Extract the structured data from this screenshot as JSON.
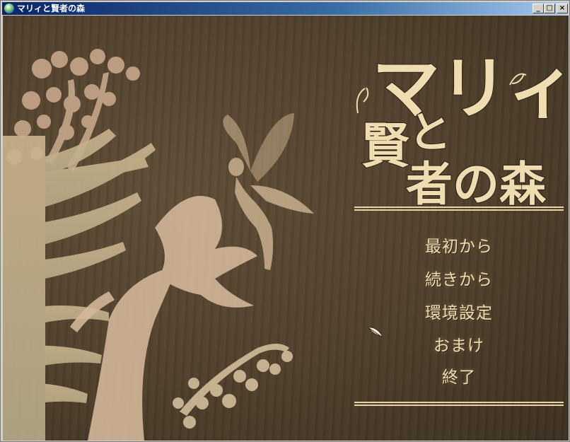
{
  "window": {
    "title": "マリィと賢者の森",
    "controls": {
      "minimize": "_",
      "maximize": "□",
      "close": "×"
    }
  },
  "logo": {
    "line1": "マリィ",
    "line2a": "賢",
    "line2b": "と",
    "line3": "者の森"
  },
  "menu": {
    "items": [
      {
        "label": "最初から"
      },
      {
        "label": "続きから"
      },
      {
        "label": "環境設定"
      },
      {
        "label": "おまけ"
      },
      {
        "label": "終了"
      }
    ]
  },
  "colors": {
    "background": "#4f3f2b",
    "menu_text": "#f1dfb1",
    "silhouette_light": "#c7b898",
    "silhouette_warm": "#d2ac88",
    "titlebar": "#0a246a"
  },
  "icons": {
    "cursor": "feather-quill-icon",
    "app": "globe-icon"
  }
}
